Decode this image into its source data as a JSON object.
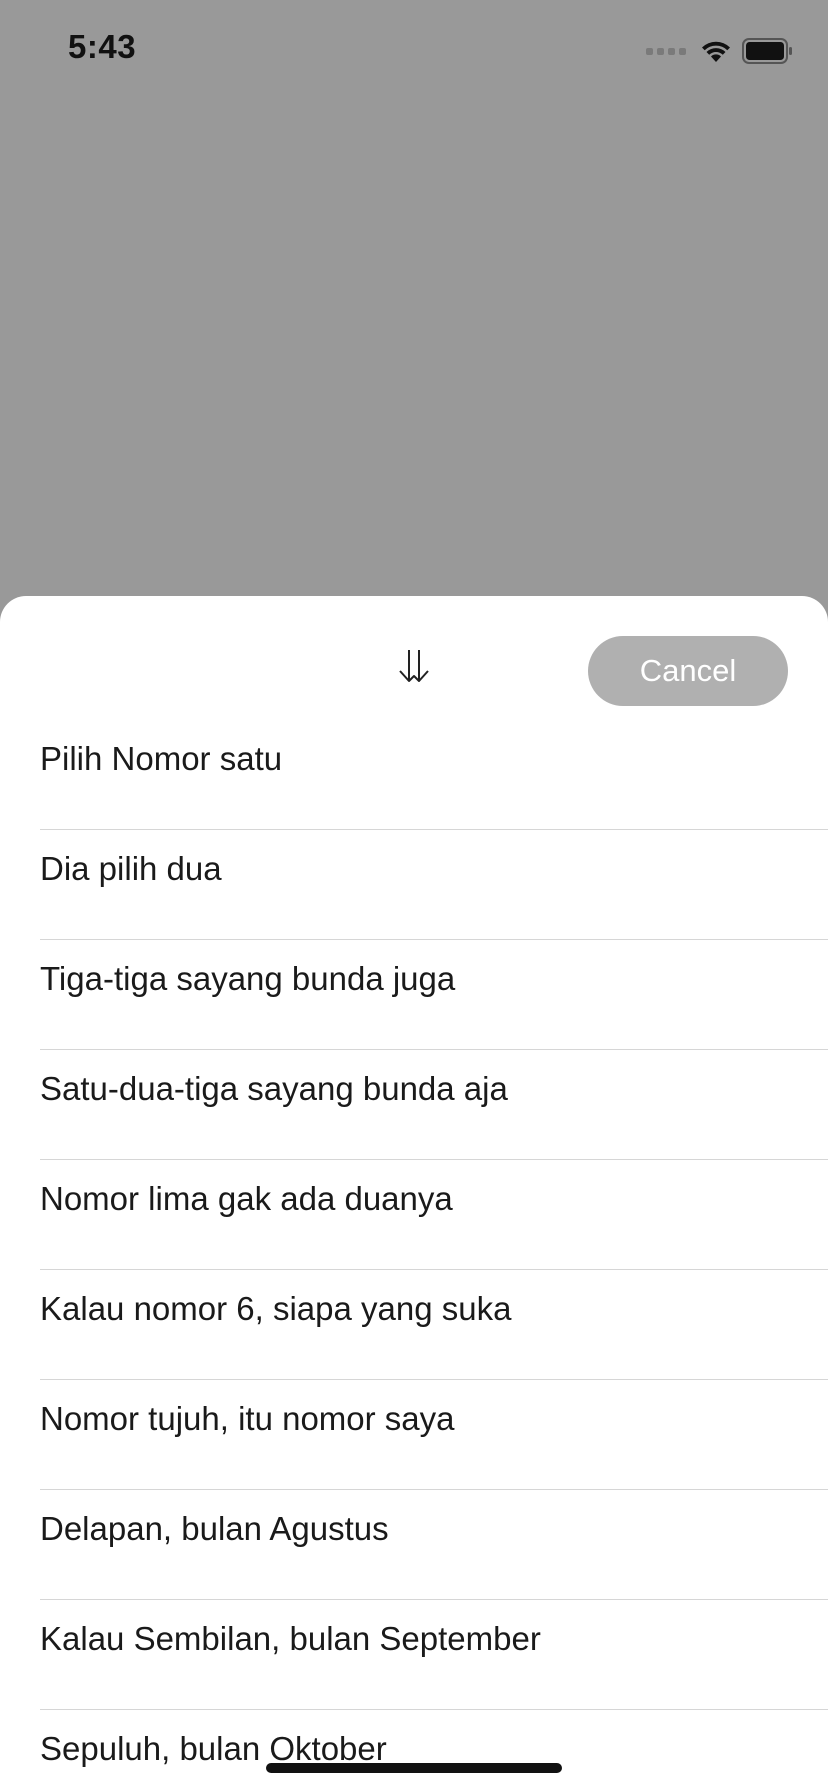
{
  "status_bar": {
    "time": "5:43",
    "icons": [
      "cellular-signal-icon",
      "wifi-icon",
      "battery-icon"
    ]
  },
  "sheet": {
    "sort_icon": "double-arrow-down-icon",
    "cancel_label": "Cancel",
    "options": [
      "Pilih Nomor satu",
      "Dia pilih dua",
      "Tiga-tiga sayang bunda juga",
      "Satu-dua-tiga sayang bunda aja",
      "Nomor lima gak ada duanya",
      "Kalau nomor 6, siapa yang suka",
      "Nomor tujuh, itu nomor saya",
      "Delapan, bulan Agustus",
      "Kalau Sembilan, bulan September",
      "Sepuluh, bulan Oktober"
    ]
  },
  "colors": {
    "dimmed_background": "#999999",
    "sheet_background": "#ffffff",
    "cancel_button_background": "#b0b0b0",
    "divider": "#d6d6d6"
  }
}
